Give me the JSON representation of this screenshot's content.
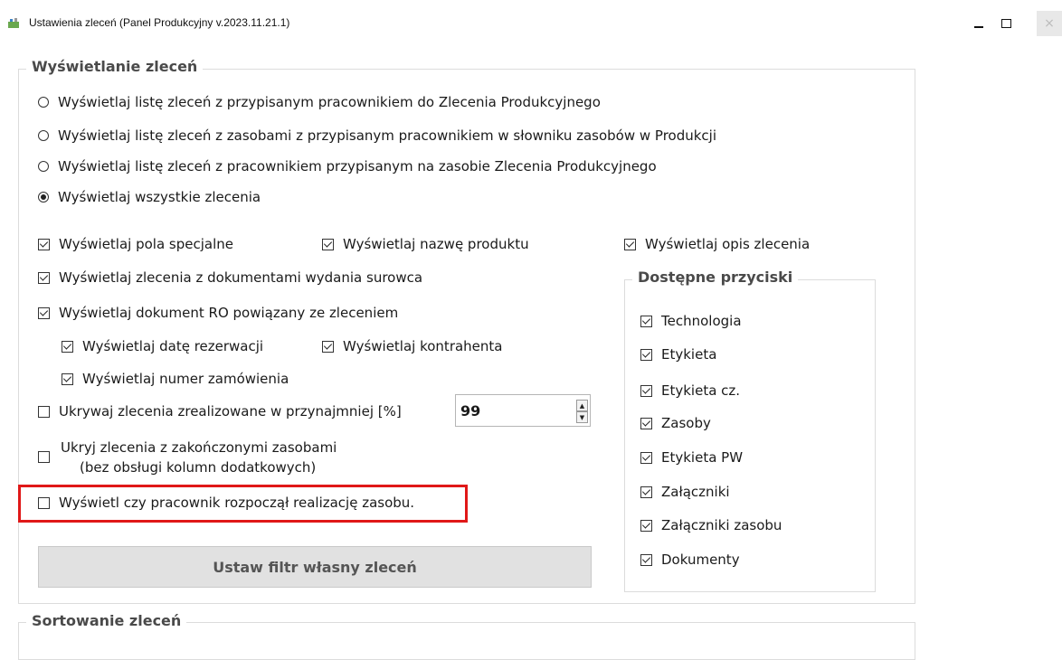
{
  "window": {
    "title": "Ustawienia zleceń (Panel Produkcyjny v.2023.11.21.1)",
    "controls": {
      "minimize": "–",
      "maximize": "☐",
      "close": "×"
    }
  },
  "display_group": {
    "legend": "Wyświetlanie zleceń",
    "radios": [
      {
        "label": "Wyświetlaj listę zleceń z przypisanym pracownikiem do Zlecenia Produkcyjnego",
        "selected": false
      },
      {
        "label": "Wyświetlaj listę zleceń z zasobami z przypisanym pracownikiem w słowniku zasobów w Produkcji",
        "selected": false
      },
      {
        "label": "Wyświetlaj listę zleceń z pracownikiem przypisanym na zasobie Zlecenia Produkcyjnego",
        "selected": false
      },
      {
        "label": "Wyświetlaj wszystkie zlecenia",
        "selected": true
      }
    ],
    "checks": {
      "special_fields": {
        "label": "Wyświetlaj pola specjalne",
        "checked": true
      },
      "product_name": {
        "label": "Wyświetlaj nazwę produktu",
        "checked": true
      },
      "order_desc": {
        "label": "Wyświetlaj opis zlecenia",
        "checked": true
      },
      "raw_docs": {
        "label": "Wyświetlaj zlecenia z dokumentami wydania surowca",
        "checked": true
      },
      "ro_doc": {
        "label": "Wyświetlaj dokument RO powiązany ze zleceniem",
        "checked": true
      },
      "reservation_date": {
        "label": "Wyświetlaj datę rezerwacji",
        "checked": true
      },
      "contractor": {
        "label": "Wyświetlaj kontrahenta",
        "checked": true
      },
      "order_number": {
        "label": "Wyświetlaj numer zamówienia",
        "checked": true
      },
      "hide_realized": {
        "label": "Ukrywaj zlecenia zrealizowane w przynajmniej [%]",
        "checked": false
      },
      "hide_finished_line1": "Ukryj zlecenia z zakończonymi zasobami",
      "hide_finished_line2": "(bez obsługi kolumn dodatkowych)",
      "hide_finished_checked": false,
      "worker_started": {
        "label": "Wyświetl czy pracownik rozpoczął realizację zasobu.",
        "checked": false
      }
    },
    "percent_value": "99",
    "filter_button": "Ustaw filtr własny zleceń"
  },
  "buttons_group": {
    "legend": "Dostępne przyciski",
    "items": [
      {
        "label": "Technologia",
        "checked": true
      },
      {
        "label": "Etykieta",
        "checked": true
      },
      {
        "label": "Etykieta cz.",
        "checked": true
      },
      {
        "label": "Zasoby",
        "checked": true
      },
      {
        "label": "Etykieta PW",
        "checked": true
      },
      {
        "label": "Załączniki",
        "checked": true
      },
      {
        "label": "Załączniki zasobu",
        "checked": true
      },
      {
        "label": "Dokumenty",
        "checked": true
      }
    ]
  },
  "sort_group": {
    "legend": "Sortowanie zleceń"
  },
  "colors": {
    "highlight": "#e01818",
    "legend_text": "#4a4a4a"
  }
}
